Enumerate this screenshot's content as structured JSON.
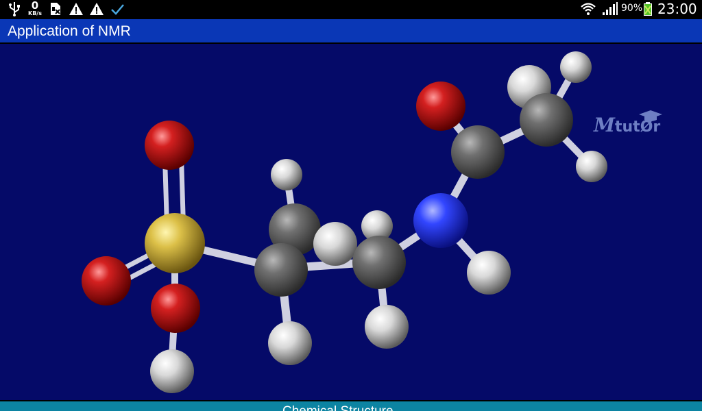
{
  "status_bar": {
    "speed_value": "0",
    "speed_unit": "KB/s",
    "battery_percent": "90%",
    "time": "23:00",
    "icons": [
      "usb-icon",
      "network-speed-icon",
      "sim-card-icon",
      "warning-icon",
      "warning-icon",
      "checkmark-icon",
      "wifi-icon",
      "signal-icon",
      "battery-icon"
    ]
  },
  "app": {
    "title": "Application of NMR",
    "bottom_label": "Chemical Structure"
  },
  "logo": {
    "brand": "Mtutor",
    "first_letter": "M",
    "rest": "tutØr"
  },
  "colors": {
    "background": "#050a68",
    "titlebar": "#0a37b6",
    "bottombar": "#0c84a2",
    "oxygen": "#c81818",
    "sulfur": "#e0c23a",
    "carbon": "#6e6e6e",
    "hydrogen": "#e8e8e8",
    "nitrogen": "#3a4cff",
    "bond": "#d8d8e6"
  }
}
